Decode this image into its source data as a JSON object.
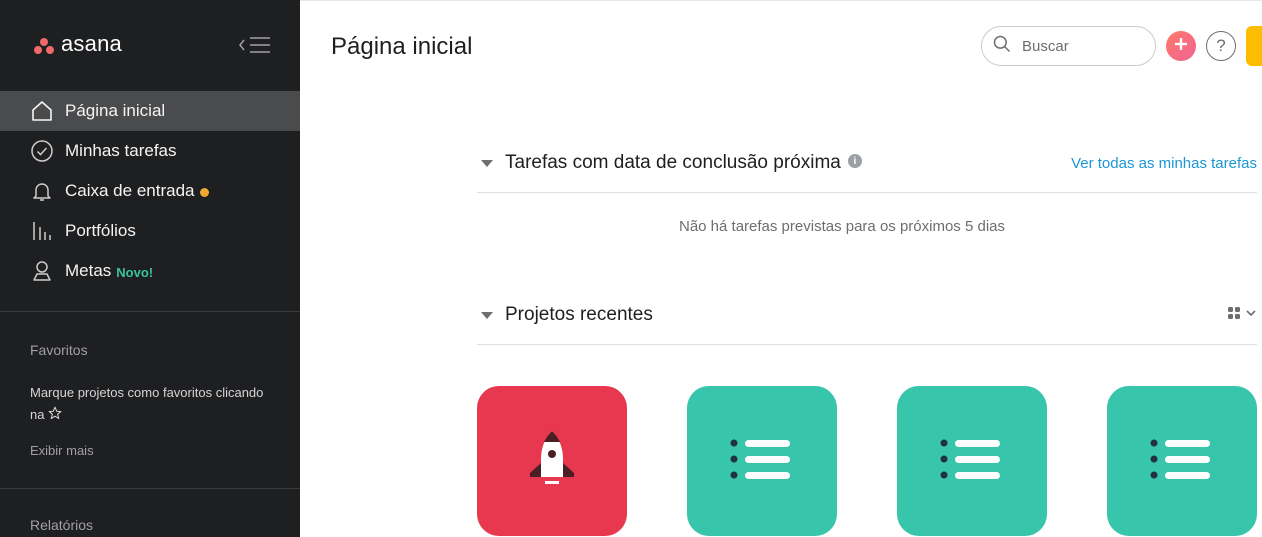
{
  "sidebar": {
    "logo_text": "asana",
    "nav": [
      {
        "label": "Página inicial",
        "icon": "home-icon",
        "active": true
      },
      {
        "label": "Minhas tarefas",
        "icon": "check-circle-icon"
      },
      {
        "label": "Caixa de entrada",
        "icon": "bell-icon",
        "badge_color": "#f1a832"
      },
      {
        "label": "Portfólios",
        "icon": "bar-chart-icon"
      },
      {
        "label": "Metas",
        "icon": "person-icon",
        "badge": "Novo!"
      }
    ],
    "favorites": {
      "title": "Favoritos",
      "hint": "Marque projetos como favoritos clicando na",
      "show_more": "Exibir mais"
    },
    "reports_title": "Relatórios"
  },
  "header": {
    "title": "Página inicial",
    "search_placeholder": "Buscar"
  },
  "tasks_section": {
    "title": "Tarefas com data de conclusão próxima",
    "see_all": "Ver todas as minhas tarefas",
    "empty": "Não há tarefas previstas para os próximos 5 dias"
  },
  "projects_section": {
    "title": "Projetos recentes",
    "projects": [
      {
        "icon": "rocket-icon",
        "color": "#e8384f"
      },
      {
        "icon": "list-icon",
        "color": "#37c5ab"
      },
      {
        "icon": "list-icon",
        "color": "#37c5ab"
      },
      {
        "icon": "list-icon",
        "color": "#37c5ab"
      }
    ]
  },
  "colors": {
    "sidebar_bg": "#1e1f21",
    "accent_link": "#1b97d4",
    "new_badge": "#3ac29a",
    "upgrade": "#fcbd01"
  }
}
